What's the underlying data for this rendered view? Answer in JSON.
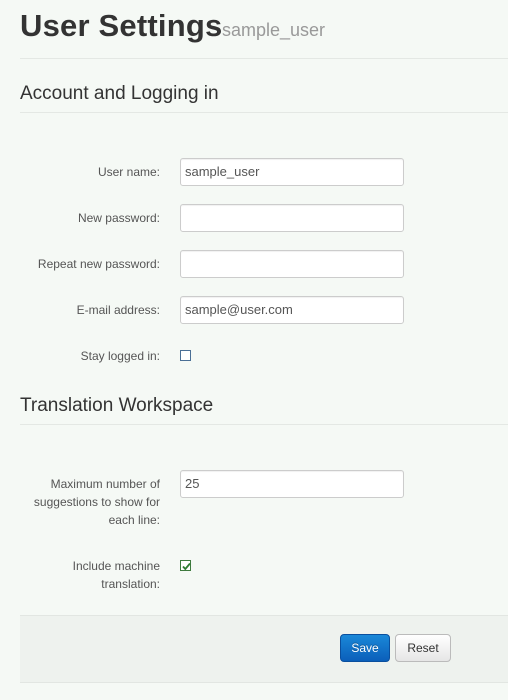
{
  "header": {
    "title": "User Settings",
    "subtitle": "sample_user"
  },
  "sections": {
    "account": {
      "title": "Account and Logging in",
      "username": {
        "label": "User name:",
        "value": "sample_user"
      },
      "new_password": {
        "label": "New password:",
        "value": ""
      },
      "repeat_password": {
        "label": "Repeat new password:",
        "value": ""
      },
      "email": {
        "label": "E-mail address:",
        "value": "sample@user.com"
      },
      "stay_logged_in": {
        "label": "Stay logged in:",
        "checked": false
      }
    },
    "translation": {
      "title": "Translation Workspace",
      "max_suggestions": {
        "label": "Maximum number of suggestions to show for each line:",
        "value": "25"
      },
      "machine_translation": {
        "label": "Include machine translation:",
        "checked": true
      }
    }
  },
  "actions": {
    "save_label": "Save",
    "reset_label": "Reset"
  },
  "colors": {
    "background": "#f5f9f5",
    "primary": "#0b6fcb",
    "check": "#2e7d32"
  }
}
